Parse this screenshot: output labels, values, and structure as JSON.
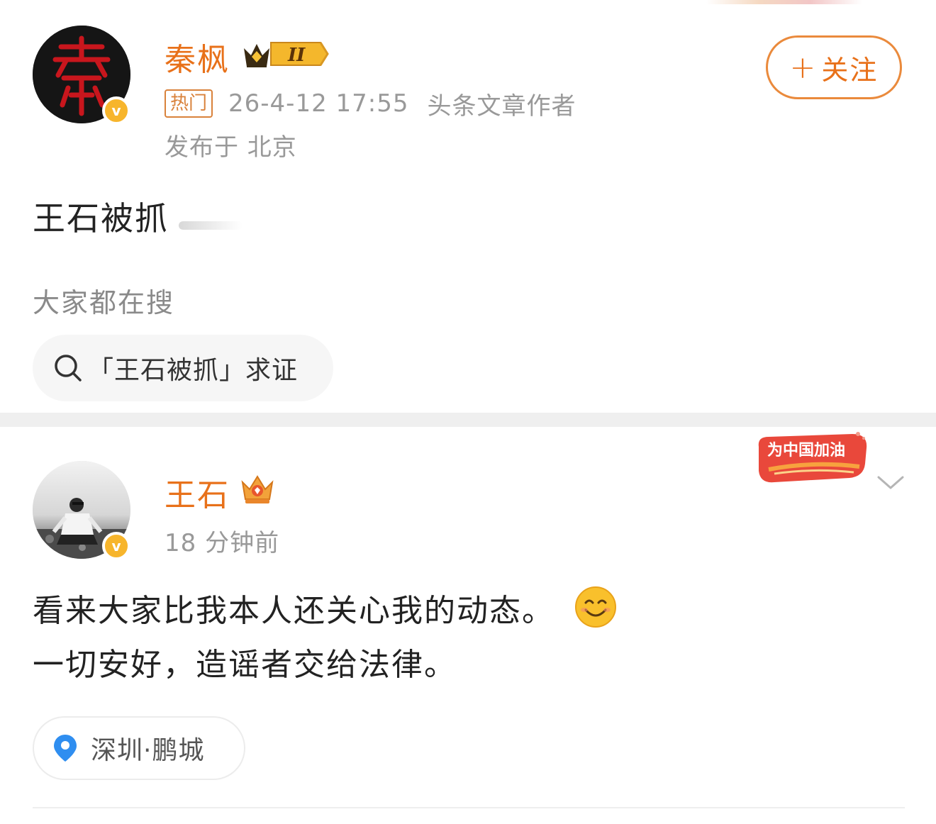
{
  "post1": {
    "user_name": "秦枫",
    "level_badge": "II",
    "avatar_char": "秦",
    "verified_mark": "v",
    "hot_tag": "热门",
    "timestamp": "26-4-12 17:55",
    "author_title": "头条文章作者",
    "location": "发布于 北京",
    "follow_plus": "+",
    "follow_label": "关注",
    "content": "王石被抓",
    "search_hint": "大家都在搜",
    "search_chip": "「王石被抓」求证",
    "icons": [
      "crown-level-icon",
      "search-icon"
    ]
  },
  "post2": {
    "user_name": "王石",
    "verified_mark": "v",
    "time": "18 分钟前",
    "frame_badge_text": "为中国加油",
    "content_line1": "看来大家比我本人还关心我的动态。",
    "content_line2": "一切安好，造谣者交给法律。",
    "location_chip": "深圳·鹏城",
    "icons": [
      "crown-icon",
      "smile-emoji-icon",
      "location-pin-icon",
      "chevron-down-icon"
    ]
  },
  "colors": {
    "accent": "#e8711a",
    "meta_gray": "#999999",
    "verified": "#f7b52c",
    "divider": "#efefef"
  }
}
